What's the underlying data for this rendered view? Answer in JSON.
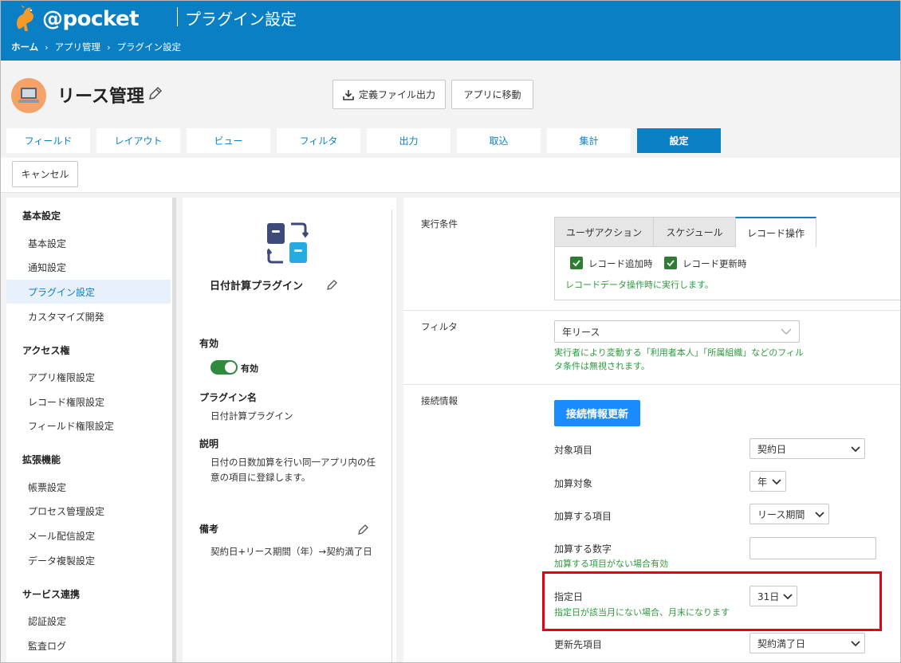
{
  "header": {
    "logo_text": "@pocket",
    "title": "プラグイン設定",
    "breadcrumb": [
      "ホーム",
      "アプリ管理",
      "プラグイン設定"
    ]
  },
  "app": {
    "name": "リース管理",
    "export_button": "定義ファイル出力",
    "goto_button": "アプリに移動"
  },
  "tabs": [
    "フィールド",
    "レイアウト",
    "ビュー",
    "フィルタ",
    "出力",
    "取込",
    "集計",
    "設定"
  ],
  "active_tab": "設定",
  "toolbar": {
    "cancel_label": "キャンセル"
  },
  "sidebar": {
    "sections": [
      {
        "title": "基本設定",
        "items": [
          "基本設定",
          "通知設定",
          "プラグイン設定",
          "カスタマイズ開発"
        ]
      },
      {
        "title": "アクセス権",
        "items": [
          "アプリ権限設定",
          "レコード権限設定",
          "フィールド権限設定"
        ]
      },
      {
        "title": "拡張機能",
        "items": [
          "帳票設定",
          "プロセス管理設定",
          "メール配信設定",
          "データ複製設定"
        ]
      },
      {
        "title": "サービス連携",
        "items": [
          "認証設定",
          "監査ログ"
        ]
      }
    ],
    "active_item": "プラグイン設定"
  },
  "plugin": {
    "name": "日付計算プラグイン",
    "enabled_label": "有効",
    "enabled_state_label": "有効",
    "enabled": true,
    "name_label": "プラグイン名",
    "name_value": "日付計算プラグイン",
    "description_label": "説明",
    "description_value": "日付の日数加算を行い同一アプリ内の任意の項目に登録します。",
    "note_label": "備考",
    "note_value": "契約日+リース期間（年）→契約満了日"
  },
  "config": {
    "execution": {
      "label": "実行条件",
      "tabs": [
        "ユーザアクション",
        "スケジュール",
        "レコード操作"
      ],
      "active_tab": "レコード操作",
      "checks": [
        {
          "label": "レコード追加時",
          "checked": true
        },
        {
          "label": "レコード更新時",
          "checked": true
        }
      ],
      "note": "レコードデータ操作時に実行します。"
    },
    "filter": {
      "label": "フィルタ",
      "value": "年リース",
      "note_line1": "実行者により変動する「利用者本人」「所属組織」などのフィル",
      "note_line2": "タ条件は無視されます。"
    },
    "connection": {
      "label": "接続情報",
      "refresh_button": "接続情報更新",
      "fields": {
        "target": {
          "label": "対象項目",
          "value": "契約日"
        },
        "add_target": {
          "label": "加算対象",
          "value": "年"
        },
        "add_item": {
          "label": "加算する項目",
          "value": "リース期間"
        },
        "add_number": {
          "label": "加算する数字",
          "value": "",
          "note": "加算する項目がない場合有効"
        },
        "specified_day": {
          "label": "指定日",
          "value": "31日",
          "note": "指定日が該当月にない場合、月末になります"
        },
        "update_target": {
          "label": "更新先項目",
          "value": "契約満了日"
        }
      }
    }
  },
  "colors": {
    "brand": "#0b7fc4",
    "accent_button": "#1a8cff",
    "success_green": "#2e9a3e",
    "highlight_red": "#e60012"
  }
}
